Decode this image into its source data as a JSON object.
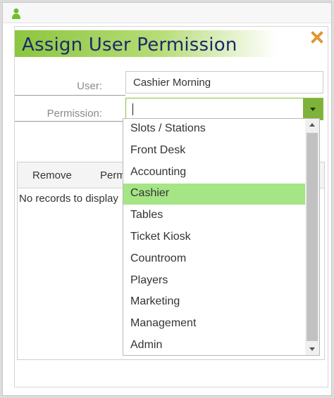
{
  "dialog": {
    "title": "Assign User Permission",
    "user_label": "User:",
    "user_value": "Cashier Morning",
    "permission_label": "Permission:",
    "permission_value": ""
  },
  "grid": {
    "toolbar": {
      "remove_label": "Remove",
      "permission_label": "Perm"
    },
    "empty_message": "No records to display"
  },
  "dropdown": {
    "items": [
      "Slots / Stations",
      "Front Desk",
      "Accounting",
      "Cashier",
      "Tables",
      "Ticket Kiosk",
      "Countroom",
      "Players",
      "Marketing",
      "Management",
      "Admin"
    ],
    "selected_index": 3
  },
  "colors": {
    "accent_green": "#8cc63f",
    "title_navy": "#1a2a6c",
    "close_orange": "#f0a030",
    "selected_row": "#a5e585"
  }
}
